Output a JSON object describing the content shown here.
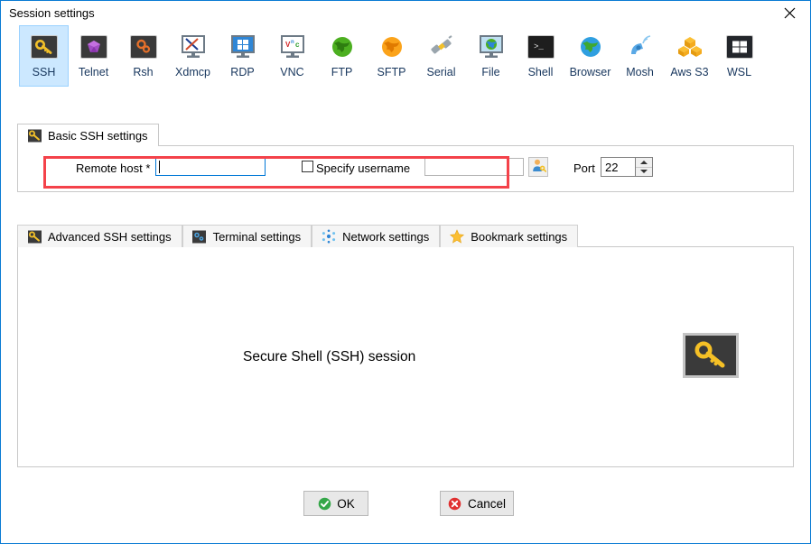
{
  "window": {
    "title": "Session settings",
    "close_icon": "close-icon",
    "accent": "#0a7bd4"
  },
  "toolbar": {
    "selected": "SSH",
    "selected_bg": "#cce8ff",
    "label_color": "#17365d",
    "items": [
      {
        "label": "SSH",
        "icon": "key-icon"
      },
      {
        "label": "Telnet",
        "icon": "gem-icon"
      },
      {
        "label": "Rsh",
        "icon": "gears-icon"
      },
      {
        "label": "Xdmcp",
        "icon": "monitor-x-icon"
      },
      {
        "label": "RDP",
        "icon": "monitor-windows-icon"
      },
      {
        "label": "VNC",
        "icon": "monitor-vnc-icon"
      },
      {
        "label": "FTP",
        "icon": "globe-green-icon"
      },
      {
        "label": "SFTP",
        "icon": "globe-orange-icon"
      },
      {
        "label": "Serial",
        "icon": "plug-icon"
      },
      {
        "label": "File",
        "icon": "monitor-globe-icon"
      },
      {
        "label": "Shell",
        "icon": "terminal-icon"
      },
      {
        "label": "Browser",
        "icon": "globe-blue-icon"
      },
      {
        "label": "Mosh",
        "icon": "satellite-icon"
      },
      {
        "label": "Aws S3",
        "icon": "aws-cubes-icon"
      },
      {
        "label": "WSL",
        "icon": "windows-icon"
      }
    ]
  },
  "basic_tabs": [
    {
      "label": "Basic SSH settings",
      "icon": "key-icon",
      "active": true
    }
  ],
  "basic_panel": {
    "remote_host": {
      "label": "Remote host *",
      "value": "",
      "placeholder": "",
      "focused": true
    },
    "specify_username": {
      "label": "Specify username",
      "checked": false
    },
    "username": {
      "value": "",
      "placeholder": ""
    },
    "user_key_button_icon": "user-key-icon",
    "port": {
      "label": "Port",
      "value": "22",
      "spinner_up_icon": "chevron-up-icon",
      "spinner_down_icon": "chevron-down-icon"
    },
    "highlight_color": "#f4424a"
  },
  "lower_tabs": [
    {
      "label": "Advanced SSH settings",
      "icon": "key-icon",
      "active": false
    },
    {
      "label": "Terminal settings",
      "icon": "terminal-settings-icon",
      "active": false
    },
    {
      "label": "Network settings",
      "icon": "network-icon",
      "active": false
    },
    {
      "label": "Bookmark settings",
      "icon": "star-icon",
      "active": false
    }
  ],
  "content": {
    "caption": "Secure Shell (SSH) session",
    "badge_icon": "key-icon"
  },
  "footer": {
    "ok": {
      "label": "OK",
      "icon": "check-circle-green-icon",
      "color": "#35a749"
    },
    "cancel": {
      "label": "Cancel",
      "icon": "x-circle-red-icon",
      "color": "#e03030"
    }
  }
}
